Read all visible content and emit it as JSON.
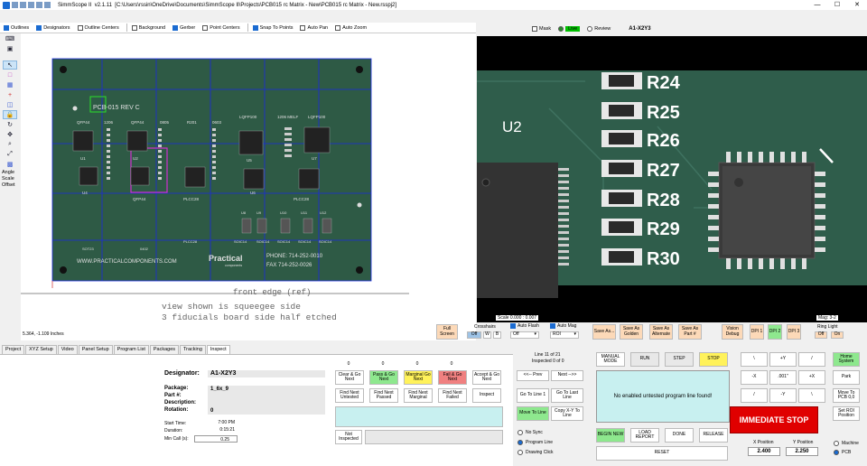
{
  "window": {
    "app_name": "SimmScope II",
    "version": "v2.1.11",
    "path": "[C:\\Users\\rssin\\OneDrive\\Documents\\SimmScope II\\Projects\\PCB015 rc Matrix - New\\PCB015 rc Matrix - New.rsspj2]",
    "minimize": "—",
    "maximize": "☐",
    "close": "✕"
  },
  "toolbar_checks": [
    {
      "label": "Outlines",
      "checked": true
    },
    {
      "label": "Designators",
      "checked": true
    },
    {
      "label": "Outline Centers",
      "checked": false
    },
    {
      "label": "Background",
      "checked": false
    },
    {
      "label": "Gerber",
      "checked": true
    },
    {
      "label": "Point Centers",
      "checked": false
    },
    {
      "label": "Snap To Points",
      "checked": true
    },
    {
      "label": "Auto Pan",
      "checked": false
    },
    {
      "label": "Auto Zoom",
      "checked": false
    }
  ],
  "sidebar": {
    "angle": "Angle",
    "scale": "Scale",
    "offset": "Offset"
  },
  "pcb": {
    "title": "PCB-015 REV C",
    "labels": [
      "QFP44",
      "1206",
      "QFP44",
      "0805",
      "R201",
      "0603",
      "LQFP100",
      "1206 MELF",
      "LQFP100"
    ],
    "row2": [
      "U1",
      "U2",
      "U3",
      "U4",
      "U5",
      "U6",
      "U7"
    ],
    "row3": [
      "U4",
      "QFP44",
      "PLCC28",
      "U6",
      "LQFP100",
      "U7",
      "PLCC28"
    ],
    "row4": [
      "U8",
      "U9",
      "U10",
      "U11",
      "U12",
      "U13",
      "U14"
    ],
    "soic": [
      "SOIC14",
      "SOIC14",
      "SOIC14",
      "SOIC14",
      "SOIC14"
    ],
    "plcc": "PLCC28",
    "sot": "SOT23",
    "r0402": "0402",
    "url": "WWW.PRACTICALCOMPONENTS.COM",
    "brand": "Practical",
    "brand_sub": "components",
    "phone": "PHONE: 714-252-0010",
    "fax": "FAX 714-252-0026",
    "front_edge": "front edge (ref)",
    "note1": "view shown is squeegee side",
    "note2": "3 fiducials board side half etched"
  },
  "coord_readout": "5.364, -1.109 Inches",
  "camera": {
    "mask": "Mask",
    "live": "Live",
    "review": "Review",
    "title": "A1-X2Y3",
    "refs": [
      "R24",
      "R25",
      "R26",
      "R27",
      "R28",
      "R29",
      "R30"
    ],
    "chip_label": "U2",
    "scale": "Scale 0.000 : 0.007",
    "mag": "Mag: 3-2"
  },
  "cam_controls": {
    "full_screen": "Full Screen",
    "crosshairs": "Crosshairs",
    "cross_off": "Off",
    "cross_w": "W",
    "cross_b": "B",
    "auto_flash": "Auto Flash",
    "auto_mag": "Auto Mag",
    "flash_val": "Off",
    "mag_val": "ROI",
    "save_as": "Save As...",
    "save_golden": "Save As Golden",
    "save_alternate": "Save As Alternate",
    "save_part": "Save As Part #",
    "vision_debug": "Vision Debug",
    "dpi1": "DPI 1",
    "dpi2": "DPI 2",
    "dpi3": "DPI 3",
    "ring_light": "Ring Light",
    "rl_off": "Off",
    "rl_on": "On"
  },
  "tabs": [
    "Project",
    "XYZ Setup",
    "Video",
    "Panel Setup",
    "Program List",
    "Packages",
    "Tracking",
    "Inspect"
  ],
  "inspect": {
    "designator_label": "Designator:",
    "designator": "A1-X2Y3",
    "package_label": "Package:",
    "package": "1_6x_9",
    "part_label": "Part #:",
    "desc_label": "Description:",
    "rotation_label": "Rotation:",
    "rotation": "0",
    "start_label": "Start Time:",
    "start": "7:00 PM",
    "duration_label": "Duration:",
    "duration": "0:15:21",
    "min_call_label": "Min Call (s):",
    "min_call": "0.25",
    "counts": [
      "0",
      "0",
      "0",
      "0"
    ],
    "btn_clear": "Clear & Go Next",
    "btn_pass": "Pass & Go Next",
    "btn_marginal": "Marginal Go Next",
    "btn_fail": "Fail & Go Next",
    "btn_accept": "Accept & Go Next",
    "find_untested": "Find Next Untested",
    "find_passed": "Find Next Passed",
    "find_marginal": "Find Next Marginal",
    "find_failed": "Find Next Failed",
    "inspect_btn": "Inspect",
    "not_inspected": "Not Inspected"
  },
  "program": {
    "line": "Line 11 of 21",
    "inspected": "Inspected 0 of 0",
    "prev": "<<-- Prev",
    "next": "Next -->>",
    "go_first": "Go To Line 1",
    "go_last": "Go To Last Line",
    "move_to_line": "Move To Line",
    "copy_xy": "Copy X-Y To Line",
    "no_sync": "No Sync",
    "program_line": "Program Line",
    "drawing_click": "Drawing Click",
    "manual": "MANUAL MODE",
    "run": "RUN",
    "step": "STEP",
    "stop": "STOP",
    "message": "No enabled untested program line found!",
    "begin_new": "BEGIN NEW",
    "load_report": "LOAD REPORT",
    "done": "DONE",
    "release": "RELEASE",
    "reset": "RESET"
  },
  "motion": {
    "back": "\\",
    "plus_y": "+Y",
    "fwd": "/",
    "minus_x": "-X",
    "step": ".001\"",
    "plus_x": "+X",
    "fwd2": "/",
    "minus_y": "-Y",
    "back2": "\\",
    "home": "Home System",
    "park": "Park",
    "move_pcb": "Move To PCB 0,0",
    "set_roi": "Set ROI Position",
    "estop": "IMMEDIATE STOP",
    "x_label": "X Position",
    "y_label": "Y Position",
    "x_val": "2.400",
    "y_val": "2.250",
    "machine": "Machine",
    "pcb": "PCB"
  }
}
